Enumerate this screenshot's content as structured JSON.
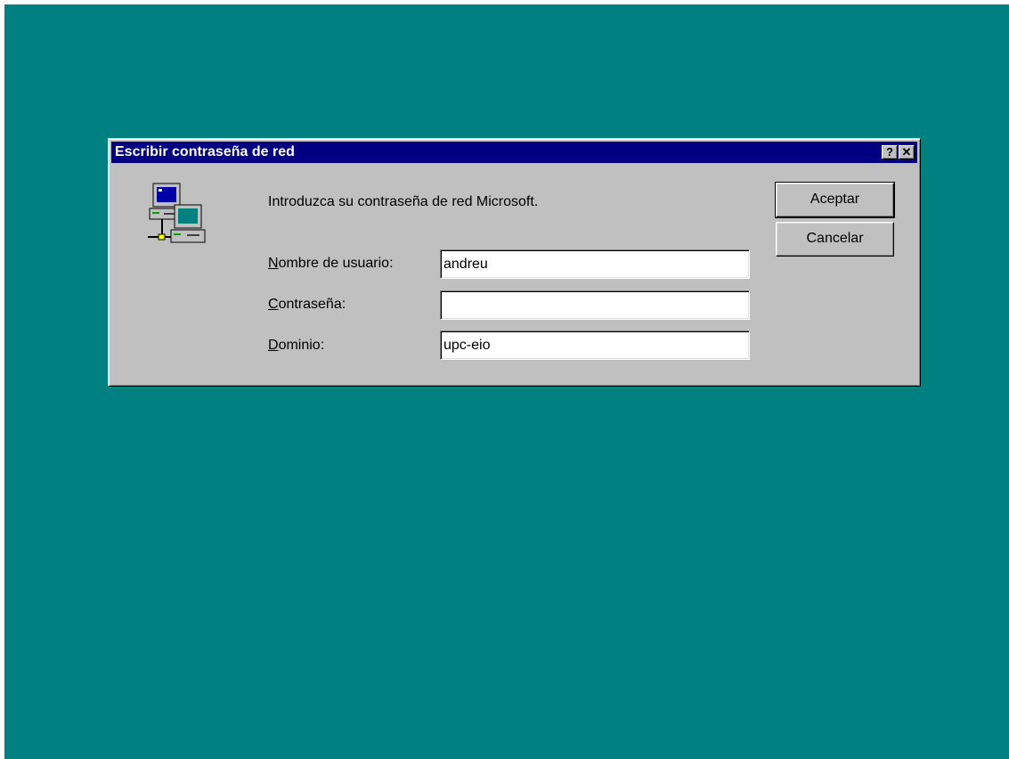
{
  "dialog": {
    "title": "Escribir contraseña de red",
    "prompt": "Introduzca su contraseña de red Microsoft.",
    "icon": "network-computers-icon",
    "title_buttons": {
      "help": "?",
      "close": "✕"
    }
  },
  "fields": {
    "username": {
      "label_accel": "N",
      "label_rest": "ombre de usuario:",
      "value": "andreu"
    },
    "password": {
      "label_accel": "C",
      "label_rest": "ontraseña:",
      "value": ""
    },
    "domain": {
      "label_accel": "D",
      "label_rest": "ominio:",
      "value": "upc-eio"
    }
  },
  "buttons": {
    "ok": "Aceptar",
    "cancel": "Cancelar"
  },
  "colors": {
    "desktop": "#008080",
    "titlebar": "#000080",
    "dialog_face": "#c0c0c0"
  }
}
